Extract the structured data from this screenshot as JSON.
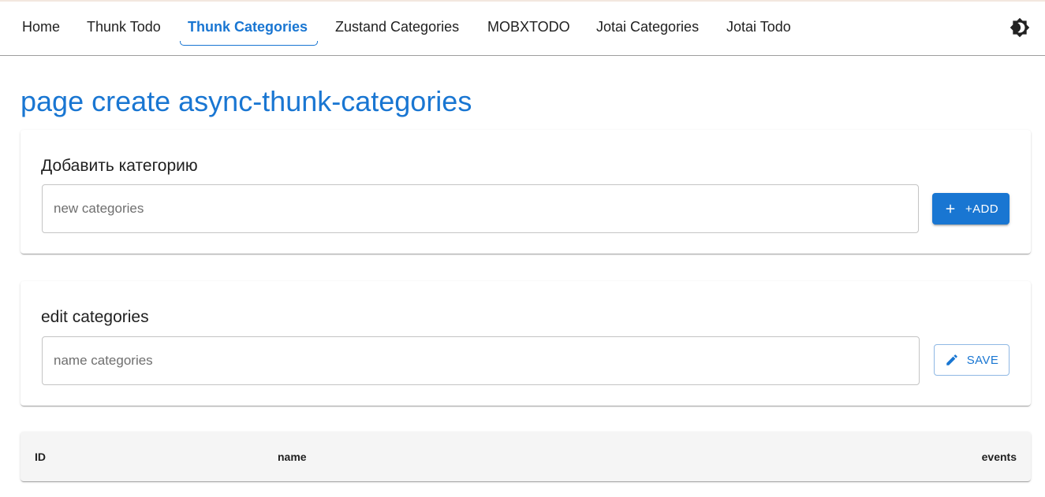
{
  "nav": {
    "items": [
      {
        "label": "Home"
      },
      {
        "label": "Thunk Todo"
      },
      {
        "label": "Thunk Categories",
        "active": true
      },
      {
        "label": "Zustand Categories"
      },
      {
        "label": "MOBXTODO"
      },
      {
        "label": "Jotai Categories"
      },
      {
        "label": "Jotai Todo"
      }
    ],
    "theme_toggle_icon": "brightness-icon"
  },
  "page": {
    "title": "page create async-thunk-categories"
  },
  "add_card": {
    "title": "Добавить категорию",
    "input_placeholder": "new categories",
    "input_value": "",
    "button_label": "+ADD",
    "button_icon": "plus-icon"
  },
  "edit_card": {
    "title": "edit categories",
    "input_placeholder": "name categories",
    "input_value": "",
    "button_label": "SAVE",
    "button_icon": "pencil-icon"
  },
  "table": {
    "columns": [
      "ID",
      "name",
      "events"
    ],
    "rows": []
  },
  "colors": {
    "primary": "#1976d2",
    "text": "#212121"
  }
}
